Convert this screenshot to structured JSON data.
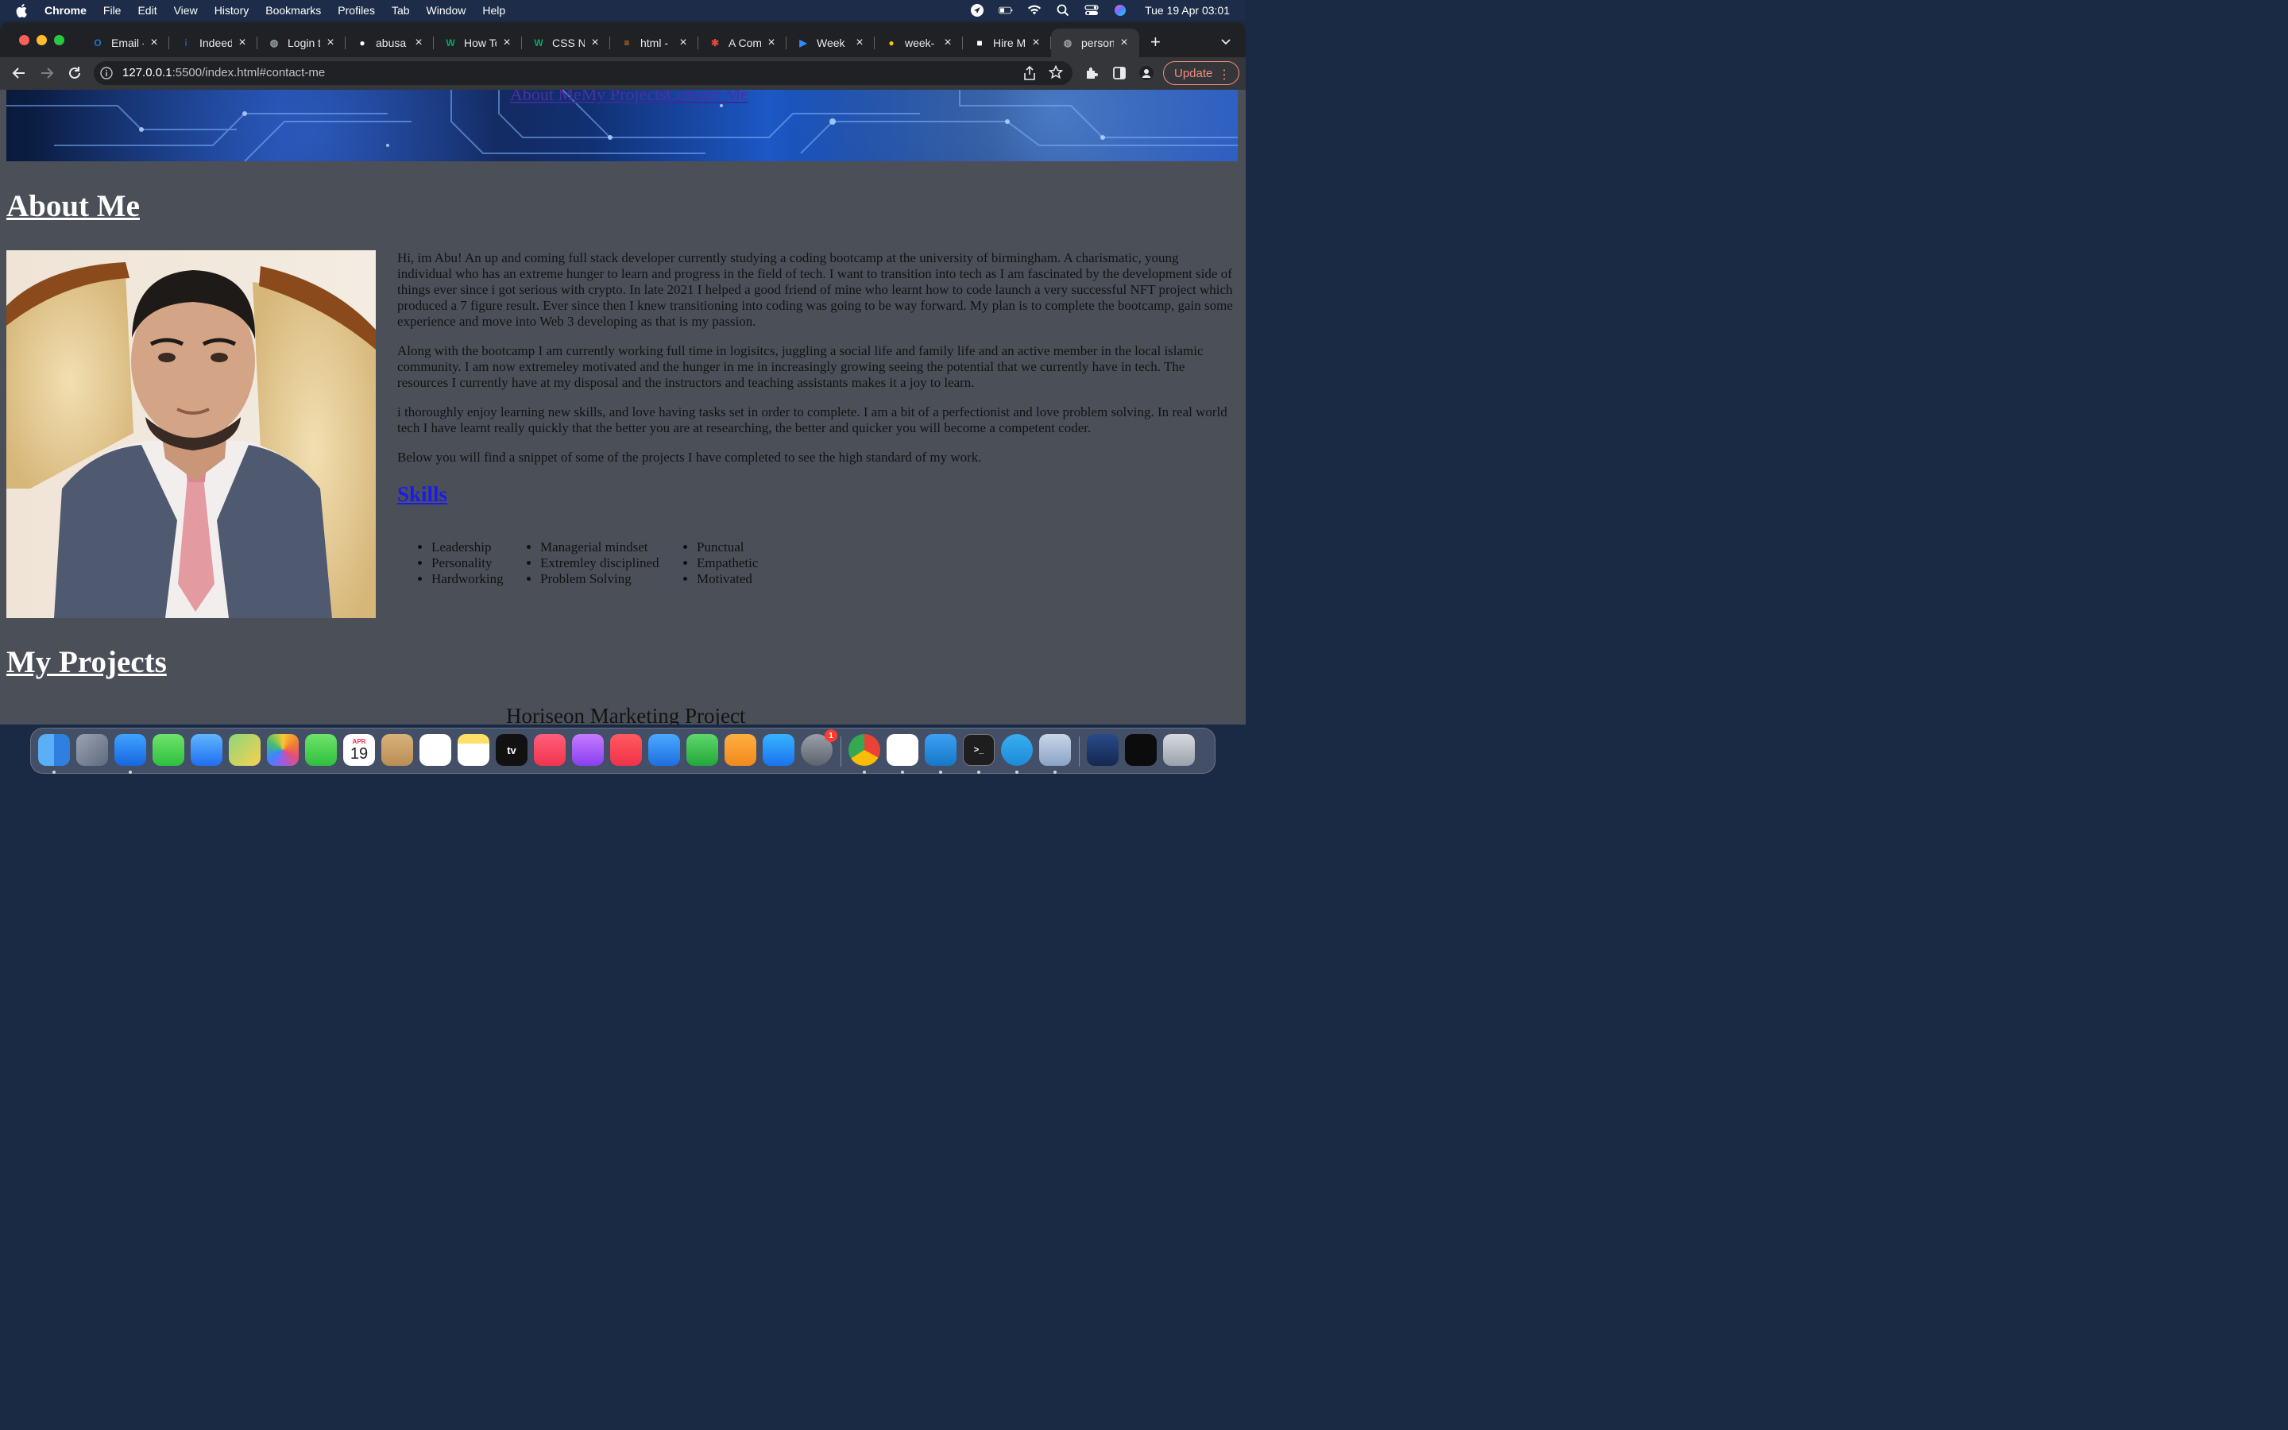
{
  "menubar": {
    "app_name": "Chrome",
    "menus": [
      "File",
      "Edit",
      "View",
      "History",
      "Bookmarks",
      "Profiles",
      "Tab",
      "Window",
      "Help"
    ],
    "clock": "Tue 19 Apr  03:01"
  },
  "tabs": [
    {
      "title": "Email -",
      "icon": "outlook-icon",
      "color": "#1976d2"
    },
    {
      "title": "Indeed",
      "icon": "indeed-icon",
      "color": "#2557a7"
    },
    {
      "title": "Login t",
      "icon": "globe-icon",
      "color": "#9aa0a6"
    },
    {
      "title": "abusa",
      "icon": "github-icon",
      "color": "#ffffff"
    },
    {
      "title": "How To",
      "icon": "w3schools-icon",
      "color": "#04aa6d"
    },
    {
      "title": "CSS N",
      "icon": "w3schools-icon",
      "color": "#04aa6d"
    },
    {
      "title": "html -",
      "icon": "stackoverflow-icon",
      "color": "#f48024"
    },
    {
      "title": "A Com",
      "icon": "asterisk-icon",
      "color": "#e8453c"
    },
    {
      "title": "Week",
      "icon": "zoom-icon",
      "color": "#2d8cff"
    },
    {
      "title": "week-",
      "icon": "drop-icon",
      "color": "#f5c518"
    },
    {
      "title": "Hire M",
      "icon": "upwork-icon",
      "color": "#ffffff"
    },
    {
      "title": "person",
      "icon": "globe-icon",
      "color": "#9aa0a6",
      "active": true
    }
  ],
  "toolbar": {
    "url_host": "127.0.0.1",
    "url_rest": ":5500/index.html#contact-me",
    "update_label": "Update"
  },
  "page": {
    "nav_links": [
      "About Me",
      "My Projects",
      "Contact Me"
    ],
    "about_heading": "About Me",
    "paragraphs": [
      "Hi, im Abu! An up and coming full stack developer currently studying a coding bootcamp at the university of birmingham. A charismatic, young individual who has an extreme hunger to learn and progress in the field of tech. I want to transition into tech as I am fascinated by the development side of things ever since i got serious with crypto. In late 2021 I helped a good friend of mine who learnt how to code launch a very successful NFT project which produced a 7 figure result. Ever since then I knew transitioning into coding was going to be way forward. My plan is to complete the bootcamp, gain some experience and move into Web 3 developing as that is my passion.",
      "Along with the bootcamp I am currently working full time in logisitcs, juggling a social life and family life and an active member in the local islamic community. I am now extremeley motivated and the hunger in me in increasingly growing seeing the potential that we currently have in tech. The resources I currently have at my disposal and the instructors and teaching assistants makes it a joy to learn.",
      "i thoroughly enjoy learning new skills, and love having tasks set in order to complete. I am a bit of a perfectionist and love problem solving. In real world tech I have learnt really quickly that the better you are at researching, the better and quicker you will become a competent coder.",
      "Below you will find a snippet of some of the projects I have completed to see the high standard of my work."
    ],
    "skills_heading": "Skills",
    "skills_columns": [
      [
        "Leadership",
        "Personality",
        "Hardworking"
      ],
      [
        "Managerial mindset",
        "Extremley disciplined",
        "Problem Solving"
      ],
      [
        "Punctual",
        "Empathetic",
        "Motivated"
      ]
    ],
    "projects_heading": "My Projects",
    "project_title": "Horiseon Marketing Project"
  },
  "dock": {
    "calendar_month": "APR",
    "calendar_day": "19",
    "tv_label": "tv",
    "settings_badge": "1",
    "apps": [
      "finder-icon",
      "launchpad-icon",
      "safari-icon",
      "messages-icon",
      "mail-icon",
      "maps-icon",
      "photos-icon",
      "facetime-icon",
      "calendar-icon",
      "contacts-icon",
      "reminders-icon",
      "notes-icon",
      "appletv-icon",
      "music-icon",
      "podcasts-icon",
      "news-icon",
      "keynote-icon",
      "numbers-icon",
      "pages-icon",
      "appstore-icon",
      "system-preferences-icon",
      "chrome-icon",
      "slack-icon",
      "vscode-icon",
      "terminal-icon",
      "telegram-icon",
      "preview-icon",
      "downloads-stack-icon",
      "screenshot-stack-icon",
      "trash-icon"
    ]
  }
}
